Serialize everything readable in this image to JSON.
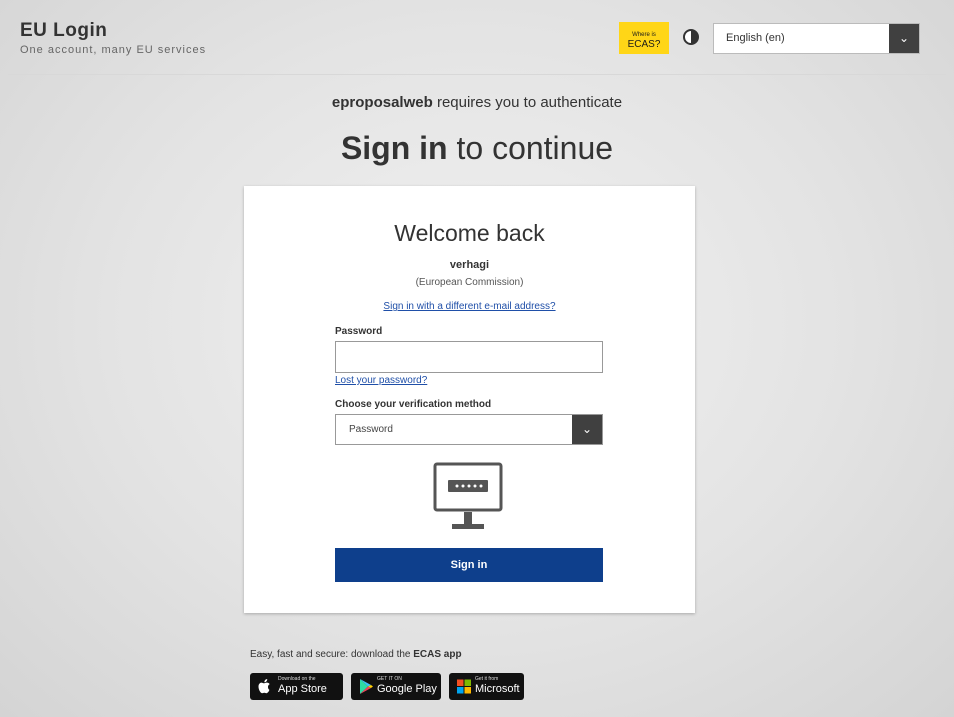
{
  "header": {
    "title": "EU Login",
    "subtitle": "One account, many EU services",
    "where_ecas_line1": "Where is",
    "where_ecas_line2": "ECAS?",
    "language": "English (en)"
  },
  "main": {
    "requires_app": "eproposalweb",
    "requires_rest": " requires you to authenticate",
    "signin_bold": "Sign in",
    "signin_rest": " to continue"
  },
  "card": {
    "welcome": "Welcome back",
    "username": "verhagi",
    "organisation": "(European Commission)",
    "different_email_link": "Sign in with a different e-mail address?",
    "password_label": "Password",
    "password_value": "",
    "lost_password_link": "Lost your password?",
    "verification_label": "Choose your verification method",
    "verification_selected": "Password",
    "signin_button": "Sign in"
  },
  "footer": {
    "easy_text": "Easy, fast and secure: download the ",
    "easy_app": "ECAS app",
    "stores": [
      {
        "small": "Download on the",
        "big": "App Store"
      },
      {
        "small": "GET IT ON",
        "big": "Google Play"
      },
      {
        "small": "Get it from",
        "big": "Microsoft"
      }
    ]
  },
  "colors": {
    "primary_button": "#0e3f8c",
    "ecas_badge": "#ffd617",
    "link": "#1f4fa8"
  }
}
